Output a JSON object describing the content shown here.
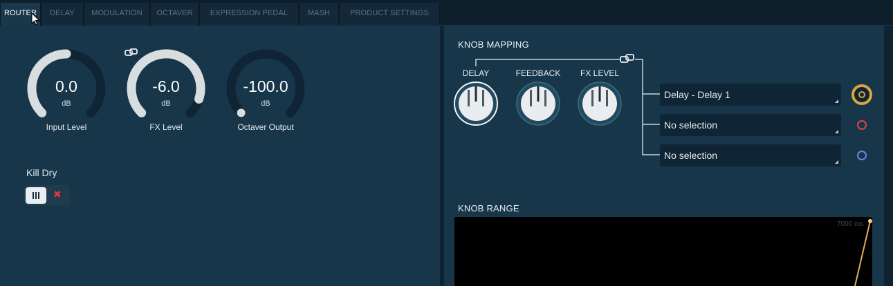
{
  "tabs": [
    {
      "label": "ROUTER",
      "active": true
    },
    {
      "label": "DELAY",
      "active": false
    },
    {
      "label": "MODULATION",
      "active": false
    },
    {
      "label": "OCTAVER",
      "active": false
    },
    {
      "label": "EXPRESSION PEDAL",
      "active": false
    },
    {
      "label": "MASH",
      "active": false
    },
    {
      "label": "PRODUCT SETTINGS",
      "active": false
    }
  ],
  "gauges": [
    {
      "value": "0.0",
      "unit": "dB",
      "label": "Input Level",
      "level": 0.5
    },
    {
      "value": "-6.0",
      "unit": "dB",
      "label": "FX Level",
      "level": 0.9
    },
    {
      "value": "-100.0",
      "unit": "dB",
      "label": "Octaver Output",
      "level": 0.0
    }
  ],
  "kill_dry": {
    "label": "Kill Dry",
    "on": true
  },
  "knob_mapping": {
    "title": "KNOB MAPPING",
    "knobs": [
      {
        "label": "DELAY"
      },
      {
        "label": "FEEDBACK"
      },
      {
        "label": "FX LEVEL"
      }
    ],
    "assignments": [
      {
        "value": "Delay - Delay 1",
        "color": "#d9a441"
      },
      {
        "value": "No selection",
        "color": "#e04545"
      },
      {
        "value": "No selection",
        "color": "#6f86e0"
      }
    ]
  },
  "knob_range": {
    "title": "KNOB RANGE",
    "max_label": "7000 ms",
    "color": "#e0b15a"
  },
  "colors": {
    "accent": "#d9a441",
    "gauge_arc": "#d8dde0",
    "gauge_track": "#0f2535"
  }
}
